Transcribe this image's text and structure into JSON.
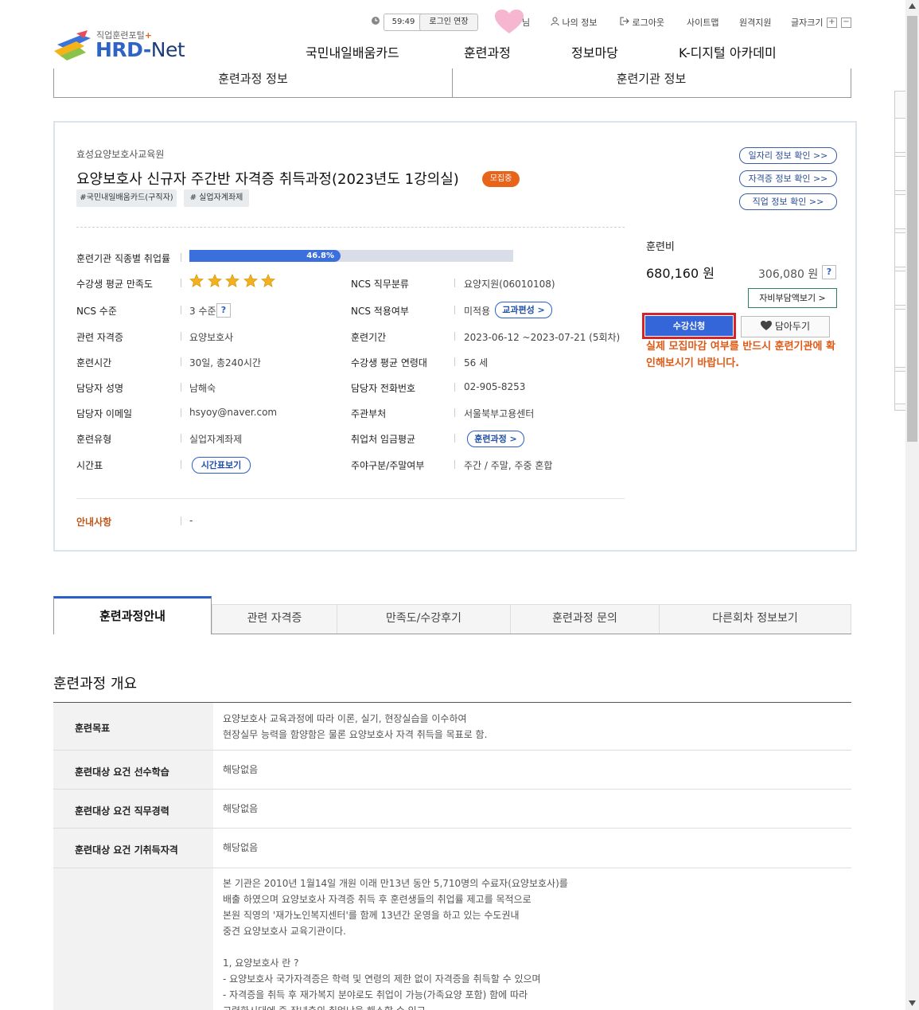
{
  "header": {
    "logo_sub": "직업훈련포털",
    "logo_main_1": "HRD-",
    "logo_main_2": "Net",
    "timer": "59:49",
    "login_extend": "로그인 연장",
    "user_suffix": "님",
    "my_info": "나의 정보",
    "logout": "로그아웃",
    "sitemap": "사이트맵",
    "remote": "원격지원",
    "font_size": "글자크기",
    "plus": "+",
    "minus": "−",
    "nav": [
      "국민내일배움카드",
      "훈련과정",
      "정보마당",
      "K-디지털 아카데미"
    ]
  },
  "top_tabs": [
    "훈련과정 정보",
    "훈련기관 정보"
  ],
  "course": {
    "org": "효성요양보호사교육원",
    "title": "요양보호사 신규자 주간반 자격증 취득과정(2023년도 1강의실)",
    "status": "모집중",
    "tags": [
      "#국민내일배움카드(구직자)",
      "# 실업자계좌제"
    ],
    "links": [
      "일자리 정보 확인 >>",
      "자격증 정보 확인 >>",
      "직업 정보 확인 >>"
    ],
    "employment_label": "훈련기관 직종별 취업률",
    "employment_rate": 46.8,
    "employment_text": "46.8%",
    "satisfaction_label": "수강생 평균 만족도",
    "satisfaction_stars": 5,
    "fields_left": [
      {
        "label": "NCS 수준",
        "value": "3 수준"
      },
      {
        "label": "관련 자격증",
        "value": "요양보호사"
      },
      {
        "label": "훈련시간",
        "value": "30일, 총240시간"
      },
      {
        "label": "담당자 성명",
        "value": "남해숙"
      },
      {
        "label": "담당자 이메일",
        "value": "hsyoy@naver.com"
      },
      {
        "label": "훈련유형",
        "value": "실업자계좌제"
      },
      {
        "label": "시간표",
        "value": ""
      }
    ],
    "fields_right": [
      {
        "label": "NCS 직무분류",
        "value": "요양지원(06010108)"
      },
      {
        "label": "NCS 적용여부",
        "value": "미적용"
      },
      {
        "label": "훈련기간",
        "value": "2023-06-12 ~2023-07-21 (5회차)"
      },
      {
        "label": "수강생 평균 연령대",
        "value": "56 세"
      },
      {
        "label": "담당자 전화번호",
        "value": "02-905-8253"
      },
      {
        "label": "주관부처",
        "value": "서울북부고용센터"
      },
      {
        "label": "취업처 임금평균",
        "value": ""
      },
      {
        "label": "주야구분/주말여부",
        "value": "주간 / 주말, 주중 혼합"
      }
    ],
    "ncs_help": "?",
    "curriculum_btn": "교과편성 >",
    "course_btn": "훈련과정 >",
    "timetable_btn": "시간표보기",
    "notice_label": "안내사항",
    "notice_value": "-",
    "fee_label": "훈련비",
    "fee": "680,160 원",
    "self_fee": "306,080 원",
    "fee_help": "?",
    "self_fee_btn": "자비부담액보기 >",
    "apply_btn": "수강신청",
    "wish_btn": "담아두기",
    "warning": "실제 모집마감 여부를 반드시 훈련기관에 확인해보시기 바랍니다."
  },
  "tabs": [
    "훈련과정안내",
    "관련 자격증",
    "만족도/수강후기",
    "훈련과정 문의",
    "다른회차 정보보기"
  ],
  "overview": {
    "title": "훈련과정 개요",
    "rows": [
      {
        "label": "훈련목표",
        "lines": [
          "요양보호사 교육과정에 따라 이론, 실기, 현장실습을 이수하여",
          "현장실무 능력을 함양함은 물론 요양보호사 자격 취득을 목표로 함."
        ]
      },
      {
        "label": "훈련대상 요건 선수학습",
        "lines": [
          "해당없음"
        ]
      },
      {
        "label": "훈련대상 요건 직무경력",
        "lines": [
          "해당없음"
        ]
      },
      {
        "label": "훈련대상 요건 기취득자격",
        "lines": [
          "해당없음"
        ]
      },
      {
        "label": "",
        "lines": [
          "본 기관은 2010년 1월14일 개원 이래 만13년 동안 5,710명의 수료자(요양보호사)를",
          "배출 하였으며 요양보호사 자격증 취득 후 훈련생들의 취업률 제고를 목적으로",
          "본원 직영의 '재가노인복지센터'를 함께 13년간 운영을 하고 있는 수도권내",
          "중견 요양보호사 교육기관이다.",
          "",
          "1, 요양보호사 란 ?",
          "- 요양보호사 국가자격증은 학력 및 연령의 제한 없이 자격증을 취득할 수 있으며",
          "- 자격증을 취득 후 재가복지 분야로도 취업이 가능(가족요양 포함) 함에 따라",
          "고령화시대에 중·장년층의 취업난을 해소할 수 있고"
        ]
      }
    ]
  },
  "colors": {
    "accent": "#3566d9",
    "status": "#e8641b",
    "highlight": "#d3242c"
  }
}
